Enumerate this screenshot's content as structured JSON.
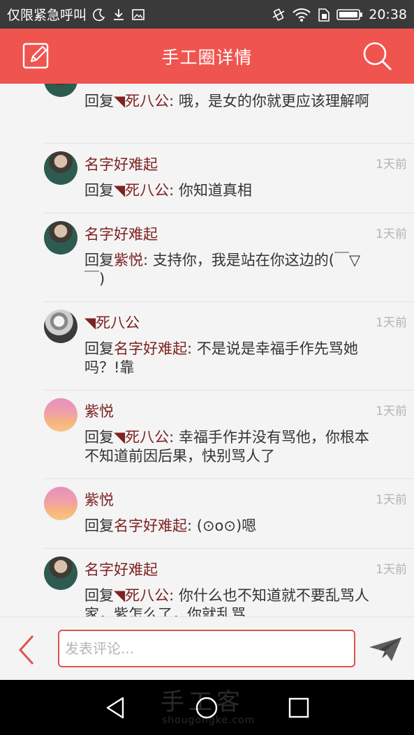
{
  "status_bar": {
    "carrier_text": "仅限紧急呼叫",
    "time": "20:38",
    "icons": [
      "moon-icon",
      "download-icon",
      "image-icon",
      "vibrate-icon",
      "wifi-icon",
      "sim-icon",
      "battery-icon"
    ]
  },
  "header": {
    "title": "手工圈详情",
    "left_icon": "edit-icon",
    "right_icon": "search-icon"
  },
  "comments": [
    {
      "name": "",
      "time": "",
      "reply_prefix": "回复",
      "reply_to": "◥死八公",
      "text": ": 哦，是女的你就更应该理解啊",
      "avatar": "girl"
    },
    {
      "name": "名字好难起",
      "time": "1天前",
      "reply_prefix": "回复",
      "reply_to": "◥死八公",
      "text": ": 你知道真相",
      "avatar": "girl"
    },
    {
      "name": "名字好难起",
      "time": "1天前",
      "reply_prefix": "回复",
      "reply_to": "紫悦",
      "text": ": 支持你，我是站在你这边的(￣▽￣)",
      "avatar": "girl"
    },
    {
      "name": "◥死八公",
      "time": "1天前",
      "reply_prefix": "回复",
      "reply_to": "名字好难起",
      "text": ": 不是说是幸福手作先骂她吗？!靠",
      "avatar": "bw"
    },
    {
      "name": "紫悦",
      "time": "1天前",
      "reply_prefix": "回复",
      "reply_to": "◥死八公",
      "text": ": 幸福手作并没有骂他，你根本不知道前因后果，快别骂人了",
      "avatar": "sunset"
    },
    {
      "name": "紫悦",
      "time": "1天前",
      "reply_prefix": "回复",
      "reply_to": "名字好难起",
      "text": ": (⊙o⊙)嗯",
      "avatar": "sunset"
    },
    {
      "name": "名字好难起",
      "time": "1天前",
      "reply_prefix": "回复",
      "reply_to": "◥死八公",
      "text": ": 你什么也不知道就不要乱骂人家，紫怎么了，你就乱骂",
      "avatar": "girl"
    }
  ],
  "comment_bar": {
    "placeholder": "发表评论...",
    "back_icon": "chevron-left-icon",
    "send_icon": "paper-plane-icon"
  },
  "watermark": {
    "text": "手工客",
    "sub": "shougongke.com"
  },
  "colors": {
    "accent": "#f0544f",
    "username": "#7e2222",
    "time": "#b3b3b3"
  }
}
